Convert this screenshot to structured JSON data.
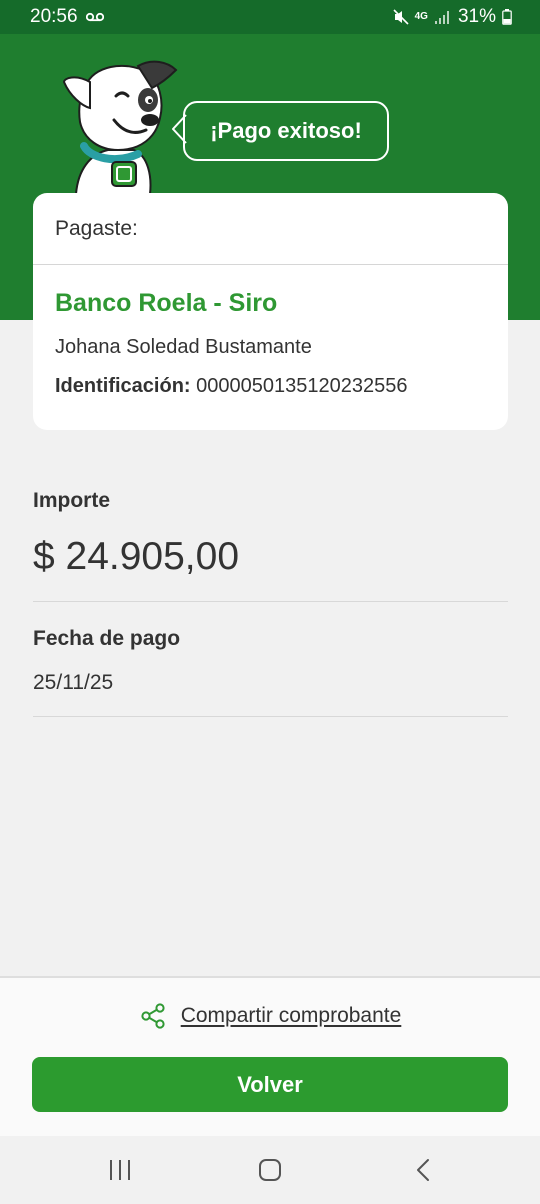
{
  "status_bar": {
    "time": "20:56",
    "network": "4G",
    "battery": "31%",
    "icons": [
      "voicemail-icon",
      "mute-icon",
      "data-arrows-icon",
      "signal-icon",
      "battery-icon"
    ]
  },
  "header": {
    "bubble_text": "¡Pago exitoso!",
    "mascot": "dog-mascot-icon",
    "colors": {
      "background": "#1f7e2f",
      "status_bar": "#156b2a"
    }
  },
  "card": {
    "title": "Pagaste:",
    "bank_name": "Banco Roela - Siro",
    "person_name": "Johana Soledad Bustamante",
    "identification_label": "Identificación:",
    "identification_value": "0000050135120232556"
  },
  "details": {
    "amount_label": "Importe",
    "amount_value": "$ 24.905,00",
    "date_label": "Fecha de pago",
    "date_value": "25/11/25"
  },
  "actions": {
    "share_label": "Compartir comprobante",
    "back_label": "Volver",
    "colors": {
      "primary_button": "#2c9b2f",
      "accent_green": "#2f9833"
    }
  },
  "nav_bar": {
    "icons": [
      "recent-apps-icon",
      "home-icon",
      "back-icon"
    ]
  }
}
